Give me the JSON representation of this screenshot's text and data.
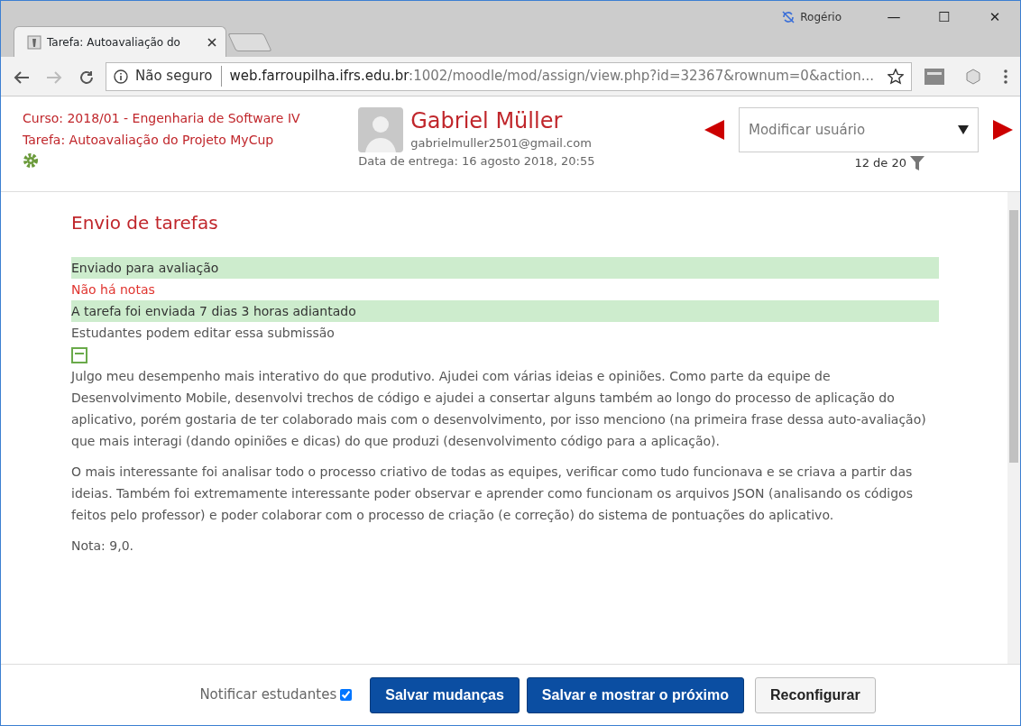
{
  "browser": {
    "tab_title": "Tarefa: Autoavaliação do",
    "profile": "Rogério",
    "window_buttons": [
      "—",
      "☐",
      "✕"
    ],
    "security": "Não seguro",
    "url_host": "web.farroupilha.ifrs.edu.br",
    "url_rest": ":1002/moodle/mod/assign/view.php?id=32367&rownum=0&action..."
  },
  "header": {
    "course": "Curso: 2018/01 - Engenharia de Software IV",
    "assignment": "Tarefa: Autoavaliação do Projeto MyCup",
    "user_name": "Gabriel Müller",
    "user_email": "gabrielmuller2501@gmail.com",
    "due_date": "Data de entrega: 16 agosto 2018, 20:55",
    "user_select": {
      "placeholder": "Modificar usuário"
    },
    "counter": "12 de 20"
  },
  "submission": {
    "title": "Envio de tarefas",
    "statuses": [
      {
        "text": "Enviado para avaliação",
        "kind": "success"
      },
      {
        "text": "Não há notas",
        "kind": "danger"
      },
      {
        "text": "A tarefa foi enviada 7 dias 3 horas adiantado",
        "kind": "success"
      },
      {
        "text": "Estudantes podem editar essa submissão",
        "kind": "plain"
      }
    ],
    "paragraphs": [
      "Julgo meu desempenho mais interativo do que produtivo. Ajudei com várias ideias e opiniões. Como parte da equipe de Desenvolvimento Mobile, desenvolvi trechos de código e ajudei a consertar alguns também ao longo do processo de aplicação do aplicativo, porém gostaria de ter colaborado mais com o desenvolvimento, por isso menciono (na primeira frase dessa auto-avaliação) que mais interagi (dando opiniões e dicas) do que produzi (desenvolvimento código para a aplicação).",
      "O mais interessante foi analisar todo o processo criativo de todas as equipes, verificar como tudo funcionava e se criava a partir das ideias. Também foi extremamente interessante poder observar e aprender como funcionam os arquivos JSON (analisando os códigos feitos pelo professor) e poder colaborar com o processo de criação (e correção) do sistema de pontuações do aplicativo.",
      "Nota: 9,0."
    ]
  },
  "footer": {
    "notify_label": "Notificar estudantes",
    "notify_checked": true,
    "buttons": [
      {
        "label": "Salvar mudanças",
        "kind": "primary"
      },
      {
        "label": "Salvar e mostrar o próximo",
        "kind": "primary"
      },
      {
        "label": "Reconfigurar",
        "kind": "secondary"
      }
    ]
  }
}
